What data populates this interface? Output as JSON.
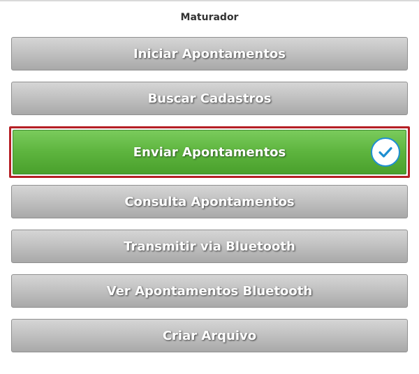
{
  "screen": {
    "title": "Maturador"
  },
  "menu": {
    "items": [
      {
        "label": "Iniciar Apontamentos"
      },
      {
        "label": "Buscar Cadastros"
      },
      {
        "label": "Enviar Apontamentos"
      },
      {
        "label": "Consulta Apontamentos"
      },
      {
        "label": "Transmitir via Bluetooth"
      },
      {
        "label": "Ver Apontamentos Bluetooth"
      },
      {
        "label": "Criar Arquivo"
      }
    ]
  },
  "icons": {
    "selected": "check-circle-icon"
  },
  "colors": {
    "button_gray": "#bdbdbd",
    "button_selected_green": "#5db43e",
    "selection_border": "#b51f24",
    "check_blue": "#1f8fd1"
  }
}
